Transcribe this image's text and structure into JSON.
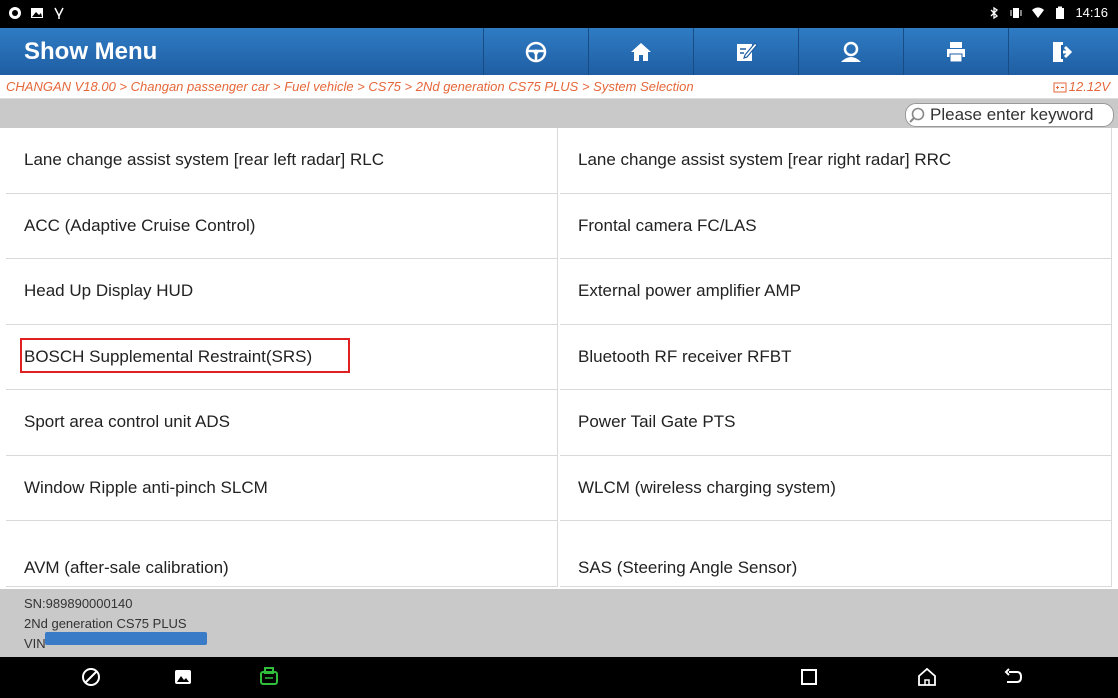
{
  "status_bar": {
    "time": "14:16"
  },
  "header": {
    "title": "Show Menu",
    "toolbar": [
      "steering-wheel-icon",
      "home-icon",
      "edit-report-icon",
      "user-icon",
      "print-icon",
      "exit-icon"
    ]
  },
  "breadcrumb": {
    "path": "CHANGAN V18.00 > Changan passenger car > Fuel vehicle > CS75 > 2Nd generation CS75 PLUS > System Selection",
    "voltage": "12.12V"
  },
  "search": {
    "placeholder": "Please enter keyword",
    "value": ""
  },
  "systems": {
    "left": [
      "Lane change assist system [rear left radar] RLC",
      "ACC (Adaptive Cruise Control)",
      "Head Up Display HUD",
      "BOSCH Supplemental Restraint(SRS)",
      "Sport area control unit ADS",
      "Window Ripple anti-pinch SLCM",
      "AVM (after-sale calibration)"
    ],
    "right": [
      "Lane change assist system [rear right radar] RRC",
      "Frontal camera FC/LAS",
      "External power amplifier AMP",
      "Bluetooth RF receiver RFBT",
      "Power Tail Gate PTS",
      "WLCM (wireless charging system)",
      "SAS (Steering Angle Sensor)"
    ],
    "highlighted": "BOSCH Supplemental Restraint(SRS)"
  },
  "footer": {
    "sn": "SN:989890000140",
    "model": "2Nd generation CS75 PLUS",
    "vin_prefix": "VIN"
  },
  "colors": {
    "header_blue": "#1f5ea3",
    "breadcrumb_orange": "#e5673a",
    "highlight_red": "#e02020",
    "vci_green": "#2fbf3a"
  }
}
